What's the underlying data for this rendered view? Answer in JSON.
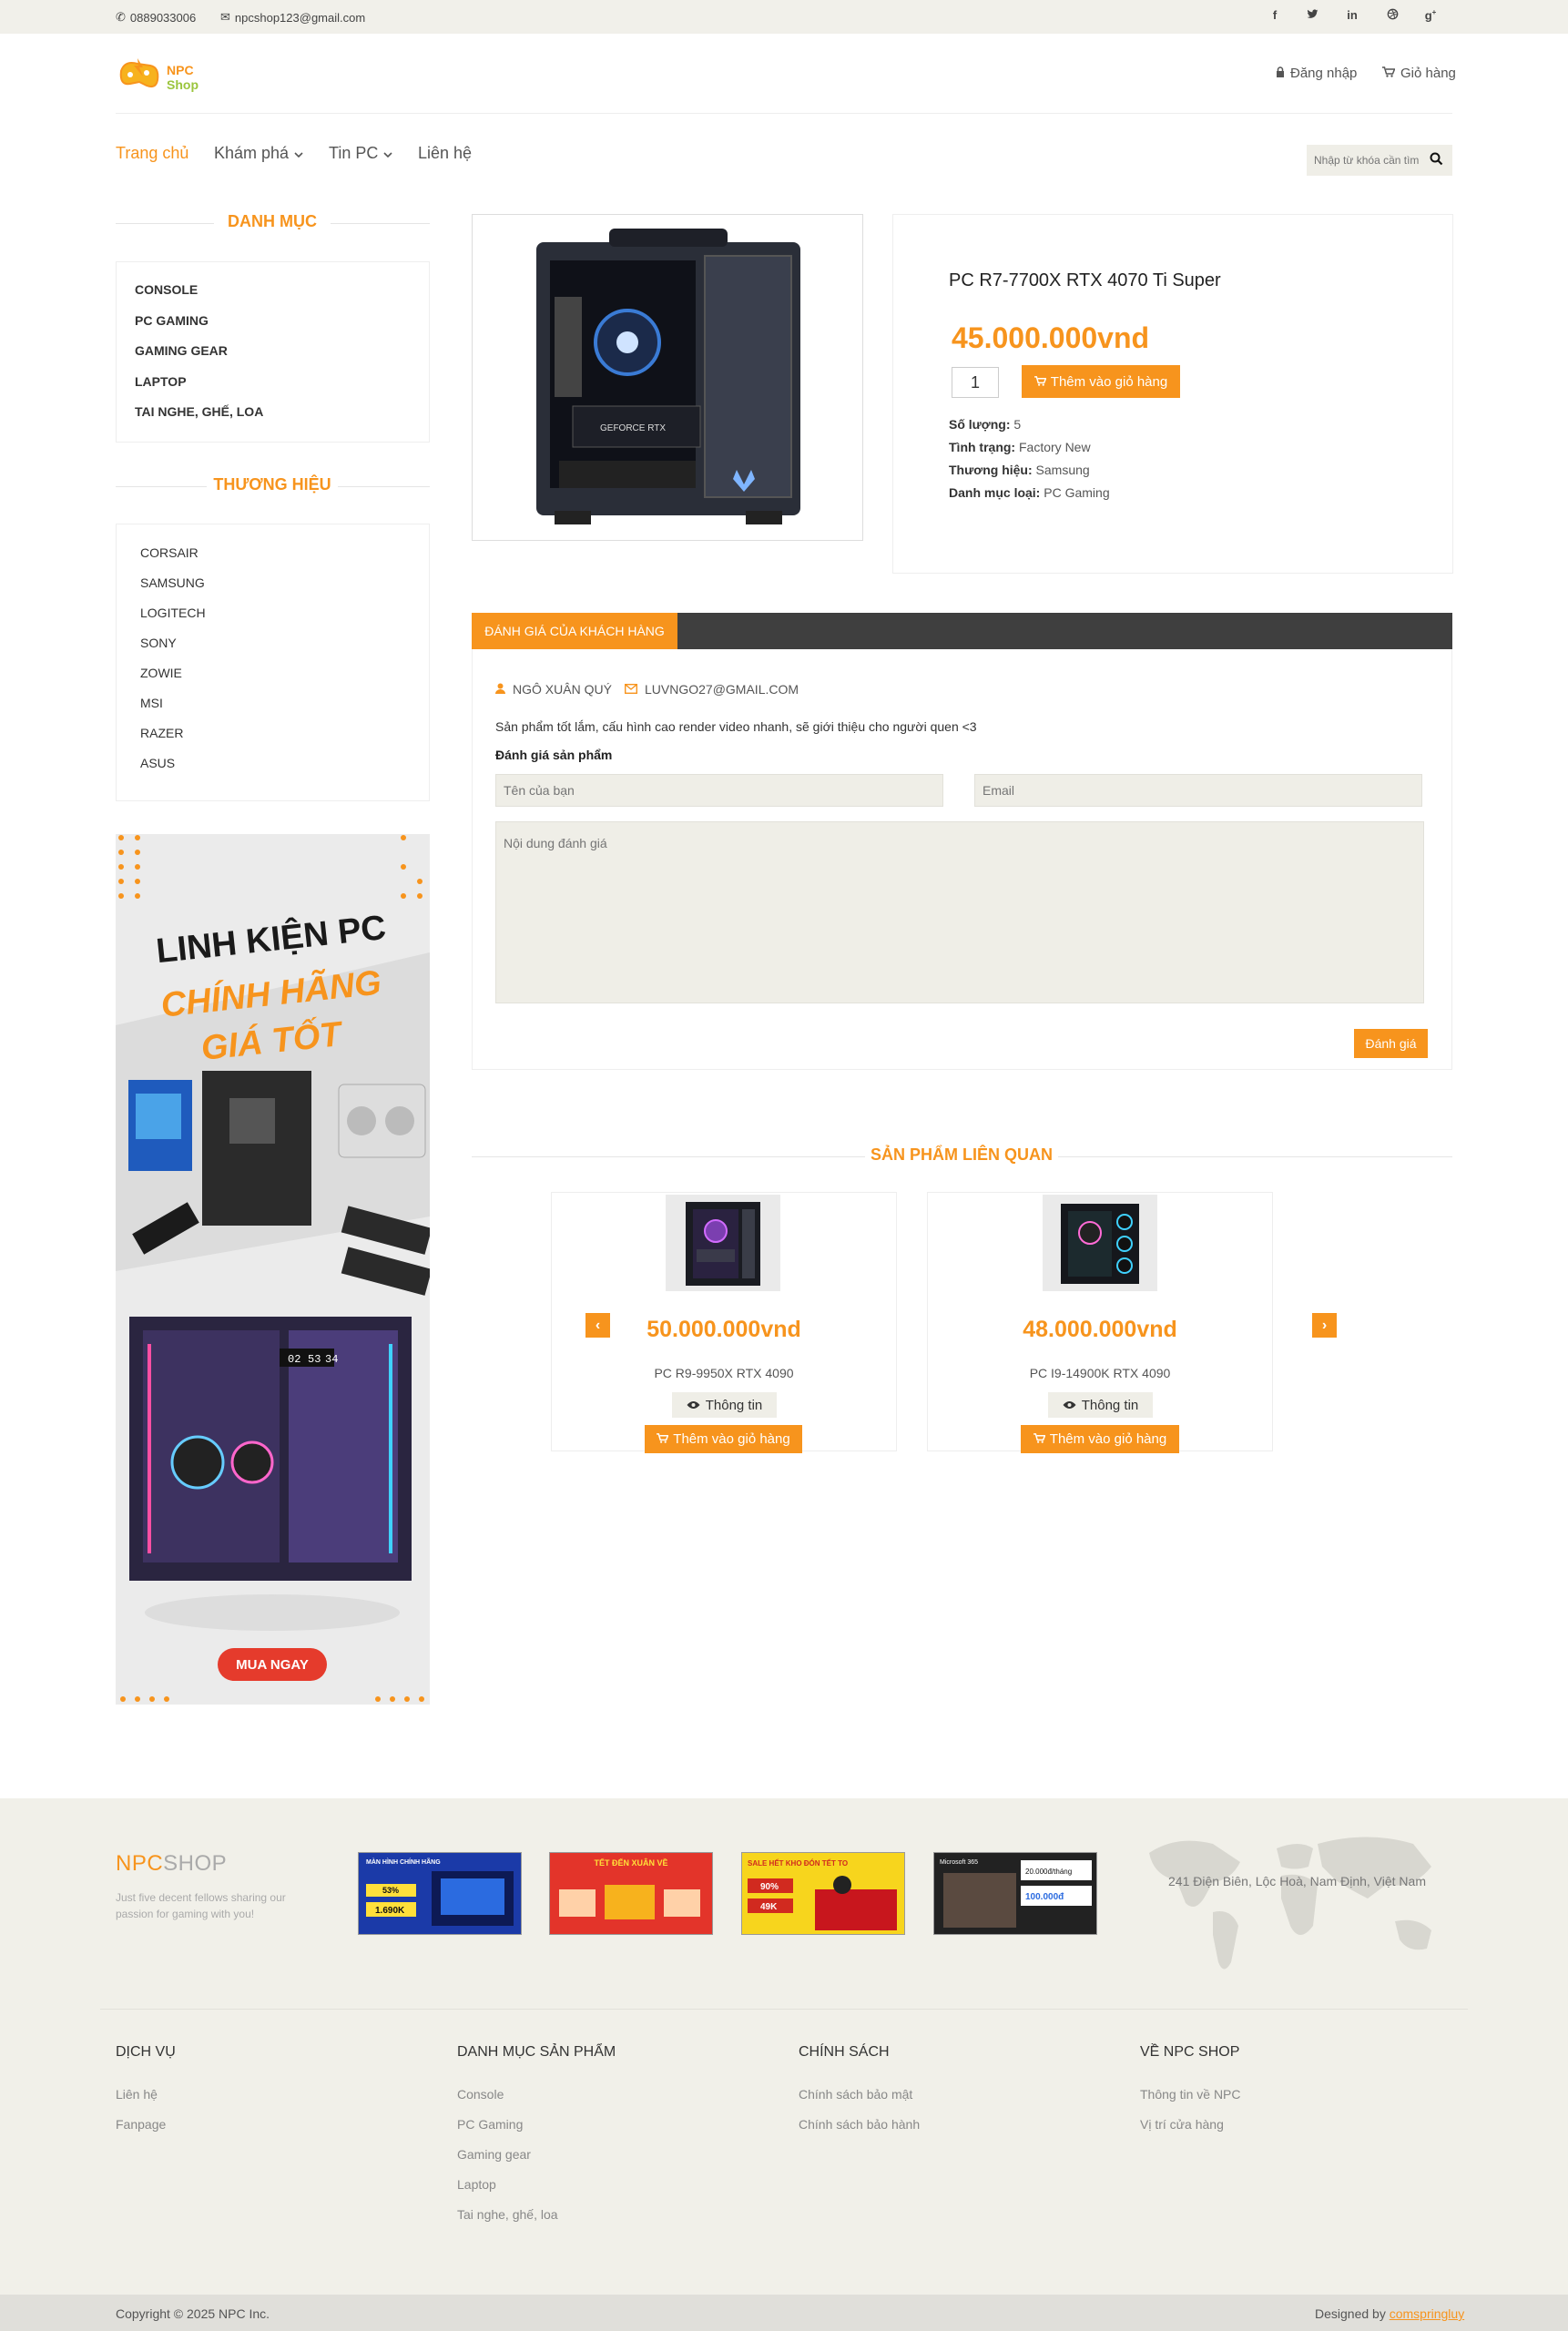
{
  "topbar": {
    "phone": "0889033006",
    "email": "npcshop123@gmail.com",
    "social": [
      "facebook-icon",
      "twitter-icon",
      "linkedin-icon",
      "dribbble-icon",
      "google-plus-icon"
    ]
  },
  "header": {
    "logo_text_1": "NPC",
    "logo_text_2": "Shop",
    "login": "Đăng nhập",
    "cart": "Giỏ hàng"
  },
  "nav": {
    "items": [
      {
        "label": "Trang chủ",
        "active": true
      },
      {
        "label": "Khám phá",
        "dropdown": true
      },
      {
        "label": "Tin PC",
        "dropdown": true
      },
      {
        "label": "Liên hệ"
      }
    ],
    "search_placeholder": "Nhập từ khóa cần tìm"
  },
  "sidebar": {
    "categories_title": "DANH MỤC",
    "categories": [
      "CONSOLE",
      "PC GAMING",
      "GAMING GEAR",
      "LAPTOP",
      "TAI NGHE, GHẾ, LOA"
    ],
    "brands_title": "THƯƠNG HIỆU",
    "brands": [
      "CORSAIR",
      "SAMSUNG",
      "LOGITECH",
      "SONY",
      "ZOWIE",
      "MSI",
      "RAZER",
      "ASUS"
    ],
    "banner": {
      "line1": "LINH KIỆN PC",
      "line2": "CHÍNH HÃNG",
      "line3": "GIÁ TỐT",
      "cta": "MUA NGAY",
      "timer": [
        "02",
        "53",
        "34"
      ]
    }
  },
  "product": {
    "name": "PC R7-7700X RTX 4070 Ti Super",
    "price": "45.000.000vnd",
    "qty": "1",
    "add_to_cart": "Thêm vào giỏ hàng",
    "specs": [
      {
        "label": "Số lượng:",
        "value": "5"
      },
      {
        "label": "Tình trạng:",
        "value": "Factory New"
      },
      {
        "label": "Thương hiệu:",
        "value": "Samsung"
      },
      {
        "label": "Danh mục loại:",
        "value": "PC Gaming"
      }
    ]
  },
  "reviews": {
    "tab": "ĐÁNH GIÁ CỦA KHÁCH HÀNG",
    "author": "NGÔ XUÂN QUÝ",
    "author_email": "LUVNGO27@GMAIL.COM",
    "comment": "Sản phẩm tốt lắm, cấu hình cao render video nhanh, sẽ giới thiệu cho người quen <3",
    "form_title": "Đánh giá sản phẩm",
    "name_placeholder": "Tên của bạn",
    "email_placeholder": "Email",
    "content_placeholder": "Nội dung đánh giá",
    "submit": "Đánh giá"
  },
  "related": {
    "title": "SẢN PHẨM LIÊN QUAN",
    "items": [
      {
        "price": "50.000.000vnd",
        "name": "PC R9-9950X RTX 4090",
        "info": "Thông tin",
        "add": "Thêm vào giỏ hàng"
      },
      {
        "price": "48.000.000vnd",
        "name": "PC I9-14900K RTX 4090",
        "info": "Thông tin",
        "add": "Thêm vào giỏ hàng"
      }
    ]
  },
  "footer": {
    "brand_1": "NPC",
    "brand_2": "SHOP",
    "tagline": "Just five decent fellows sharing our passion for gaming with you!",
    "address": "241 Điện Biên, Lộc Hoà, Nam Định, Việt Nam",
    "promos": [
      {
        "title": "MÀN HÌNH CHÍNH HÃNG",
        "badge": "53%",
        "price": "1.690K"
      },
      {
        "title": "TẾT ĐẾN XUÂN VỀ"
      },
      {
        "title": "SALE HẾT KHO ĐÓN TẾT TO",
        "badge": "90%",
        "price": "49K"
      },
      {
        "title": "Microsoft 365",
        "price": "20.000đ/tháng",
        "badge": "100.000đ"
      }
    ],
    "columns": [
      {
        "title": "DỊCH VỤ",
        "links": [
          "Liên hệ",
          "Fanpage"
        ]
      },
      {
        "title": "DANH MỤC SẢN PHẨM",
        "links": [
          "Console",
          "PC Gaming",
          "Gaming gear",
          "Laptop",
          "Tai nghe, ghế, loa"
        ]
      },
      {
        "title": "CHÍNH SÁCH",
        "links": [
          "Chính sách bảo mật",
          "Chính sách bảo hành"
        ]
      },
      {
        "title": "VỀ NPC SHOP",
        "links": [
          "Thông tin về NPC",
          "Vị trí cửa hàng"
        ]
      }
    ],
    "copyright": "Copyright © 2025 NPC Inc.",
    "designed_by": "Designed by",
    "designer": "comspringluy"
  }
}
